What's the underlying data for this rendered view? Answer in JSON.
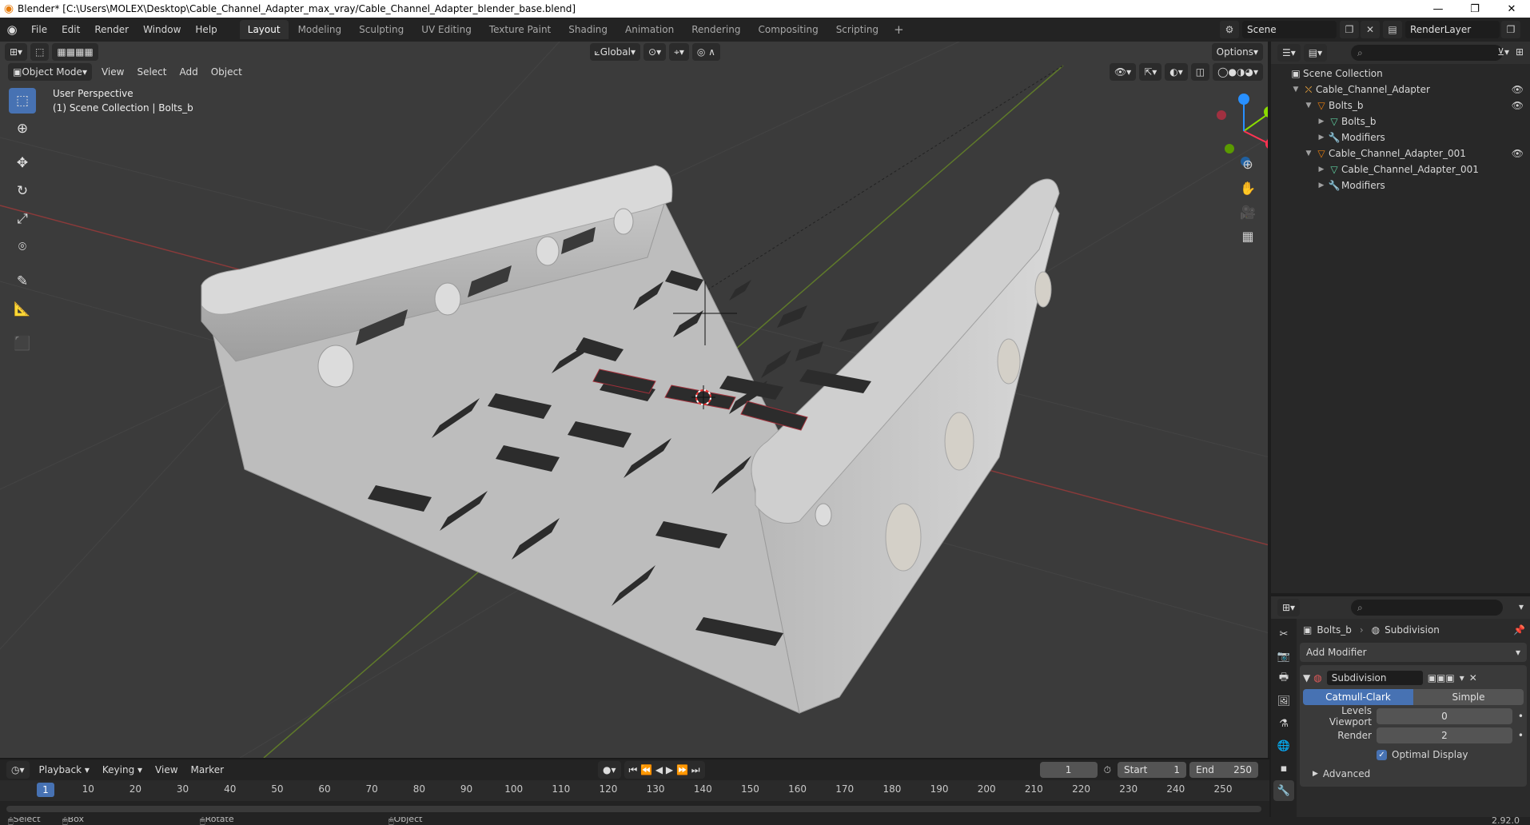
{
  "window": {
    "title": "Blender* [C:\\Users\\MOLEX\\Desktop\\Cable_Channel_Adapter_max_vray/Cable_Channel_Adapter_blender_base.blend]",
    "minimize": "—",
    "maximize": "❐",
    "close": "✕"
  },
  "menu": [
    "File",
    "Edit",
    "Render",
    "Window",
    "Help"
  ],
  "workspaces": [
    "Layout",
    "Modeling",
    "Sculpting",
    "UV Editing",
    "Texture Paint",
    "Shading",
    "Animation",
    "Rendering",
    "Compositing",
    "Scripting"
  ],
  "active_workspace": "Layout",
  "scene": {
    "name": "Scene",
    "view_layer": "RenderLayer"
  },
  "viewport": {
    "mode": "Object Mode",
    "menu": [
      "View",
      "Select",
      "Add",
      "Object"
    ],
    "orientation": "Global",
    "options_label": "Options",
    "perspective": "User Perspective",
    "collection_info": "(1) Scene Collection | Bolts_b",
    "axes": {
      "x": "X",
      "y": "Y",
      "z": "Z"
    }
  },
  "timeline": {
    "menu": [
      "Playback",
      "Keying",
      "View",
      "Marker"
    ],
    "current_frame": "1",
    "start_label": "Start",
    "start": "1",
    "end_label": "End",
    "end": "250",
    "ticks": [
      "1",
      "10",
      "20",
      "30",
      "40",
      "50",
      "60",
      "70",
      "80",
      "90",
      "100",
      "110",
      "120",
      "130",
      "140",
      "150",
      "160",
      "170",
      "180",
      "190",
      "200",
      "210",
      "220",
      "230",
      "240",
      "250"
    ]
  },
  "status": {
    "select": "Select",
    "box_select": "Box Select",
    "rotate_view": "Rotate View",
    "context_menu": "Object Context Menu",
    "version": "2.92.0"
  },
  "outliner": {
    "root": "Scene Collection",
    "rows": [
      {
        "label": "Cable_Channel_Adapter",
        "indent": 1,
        "icon": "armature-icon",
        "arrow": "▼",
        "eye": true
      },
      {
        "label": "Bolts_b",
        "indent": 2,
        "icon": "object-icon",
        "arrow": "▼",
        "eye": true
      },
      {
        "label": "Bolts_b",
        "indent": 3,
        "icon": "mesh-icon",
        "arrow": "▶",
        "eye": false
      },
      {
        "label": "Modifiers",
        "indent": 3,
        "icon": "wrench-icon",
        "arrow": "▶",
        "eye": false
      },
      {
        "label": "Cable_Channel_Adapter_001",
        "indent": 2,
        "icon": "object-icon",
        "arrow": "▼",
        "eye": true
      },
      {
        "label": "Cable_Channel_Adapter_001",
        "indent": 3,
        "icon": "mesh-icon",
        "arrow": "▶",
        "eye": false
      },
      {
        "label": "Modifiers",
        "indent": 3,
        "icon": "wrench-icon",
        "arrow": "▶",
        "eye": false
      }
    ]
  },
  "properties": {
    "object": "Bolts_b",
    "modifier_context": "Subdivision",
    "add_modifier": "Add Modifier",
    "modifier": {
      "name": "Subdivision",
      "type_a": "Catmull-Clark",
      "type_b": "Simple",
      "levels_viewport_label": "Levels Viewport",
      "levels_viewport": "0",
      "render_label": "Render",
      "render": "2",
      "optimal_display": "Optimal Display",
      "advanced": "Advanced"
    }
  },
  "colors": {
    "accent": "#4772b3",
    "x_axis": "#ff3352",
    "y_axis": "#8bdc00",
    "z_axis": "#2890ff",
    "object_orange": "#e87d0d"
  }
}
